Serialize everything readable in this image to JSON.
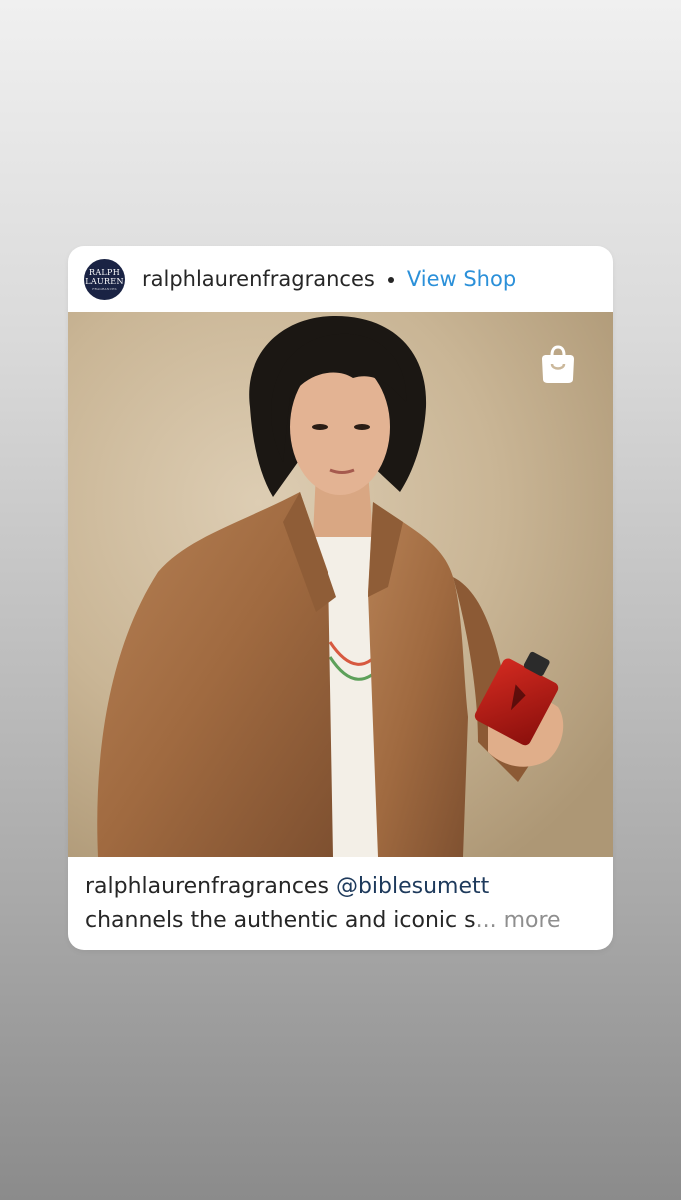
{
  "post": {
    "account": {
      "username": "ralphlaurenfragrances",
      "avatar_text": [
        "RALPH",
        "LAUREN",
        "FRAGRANCES"
      ],
      "avatar_color": "#1a2344"
    },
    "separator": "•",
    "view_shop_label": "View Shop",
    "view_shop_color": "#2b90d9",
    "photo": {
      "description_icon": "shopping-bag-icon"
    },
    "caption": {
      "username": "ralphlaurenfragrances",
      "mention": "@biblesumett",
      "text": "channels the authentic and iconic s",
      "ellipsis": "...",
      "more_label": "more"
    }
  }
}
